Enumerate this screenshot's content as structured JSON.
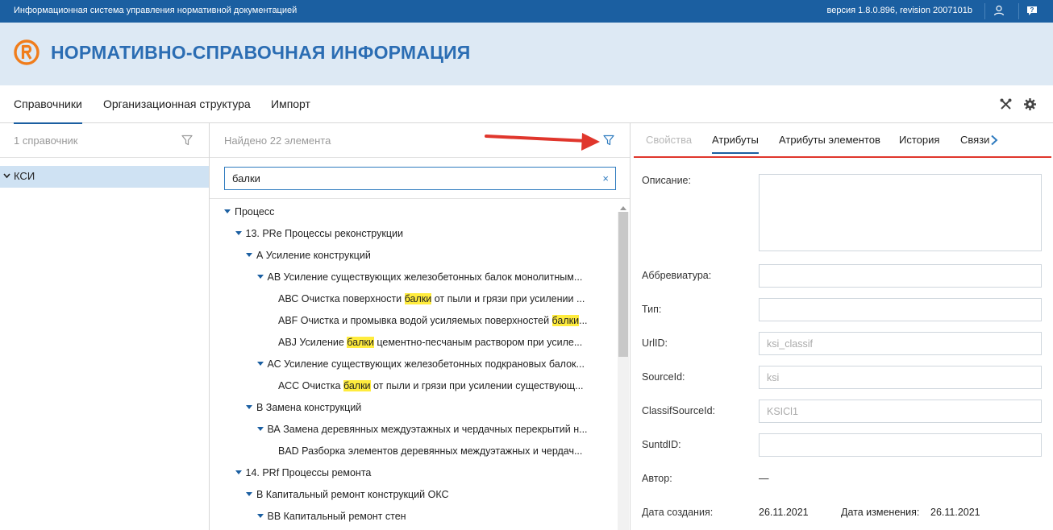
{
  "topbar": {
    "app_title": "Информационная система управления нормативной документацией",
    "version": "версия 1.8.0.896, revision 2007101b",
    "user_icon": "user-icon",
    "help_icon": "help-chat-icon"
  },
  "header": {
    "logo_icon": "brand-logo-icon",
    "title": "НОРМАТИВНО-СПРАВОЧНАЯ ИНФОРМАЦИЯ"
  },
  "nav": {
    "tabs": [
      {
        "label": "Справочники",
        "active": true
      },
      {
        "label": "Организационная структура",
        "active": false
      },
      {
        "label": "Импорт",
        "active": false
      }
    ],
    "tools_icon": "tools-icon",
    "settings_icon": "gear-icon"
  },
  "left_panel": {
    "count": "1 справочник",
    "filter_icon": "filter-icon",
    "items": [
      {
        "label": "КСИ",
        "selected": true
      }
    ]
  },
  "middle_panel": {
    "count": "Найдено 22 элемента",
    "filter_icon": "filter-icon",
    "search": {
      "value": "балки",
      "clear": "×"
    },
    "tree": [
      {
        "level": 0,
        "caret": true,
        "pre": "Процесс",
        "hl": "",
        "post": ""
      },
      {
        "level": 1,
        "caret": true,
        "pre": "13. PRe Процессы реконструкции",
        "hl": "",
        "post": ""
      },
      {
        "level": 2,
        "caret": true,
        "pre": "А Усиление конструкций",
        "hl": "",
        "post": ""
      },
      {
        "level": 3,
        "caret": true,
        "pre": "АВ Усиление существующих железобетонных балок монолитным...",
        "hl": "",
        "post": ""
      },
      {
        "level": 4,
        "caret": false,
        "pre": "АВС Очистка поверхности ",
        "hl": "балки",
        "post": " от пыли и грязи при усилении ..."
      },
      {
        "level": 4,
        "caret": false,
        "pre": "ABF Очистка и промывка водой усиляемых поверхностей ",
        "hl": "балки",
        "post": "..."
      },
      {
        "level": 4,
        "caret": false,
        "pre": "ABJ Усиление ",
        "hl": "балки",
        "post": " цементно-песчаным раствором при усиле..."
      },
      {
        "level": 3,
        "caret": true,
        "pre": "АС Усиление существующих железобетонных подкрановых балок...",
        "hl": "",
        "post": ""
      },
      {
        "level": 4,
        "caret": false,
        "pre": "АСС Очистка ",
        "hl": "балки",
        "post": " от пыли и грязи при усилении существующ..."
      },
      {
        "level": 2,
        "caret": true,
        "pre": "В Замена конструкций",
        "hl": "",
        "post": ""
      },
      {
        "level": 3,
        "caret": true,
        "pre": "ВА Замена деревянных междуэтажных и чердачных перекрытий н...",
        "hl": "",
        "post": ""
      },
      {
        "level": 4,
        "caret": false,
        "pre": "BAD Разборка элементов деревянных междуэтажных и чердач...",
        "hl": "",
        "post": ""
      },
      {
        "level": 1,
        "caret": true,
        "pre": "14. PRf Процессы ремонта",
        "hl": "",
        "post": ""
      },
      {
        "level": 2,
        "caret": true,
        "pre": "В Капитальный ремонт конструкций ОКС",
        "hl": "",
        "post": ""
      },
      {
        "level": 3,
        "caret": true,
        "pre": "ВВ Капитальный ремонт стен",
        "hl": "",
        "post": ""
      }
    ]
  },
  "right_panel": {
    "tabs": [
      {
        "label": "Свойства",
        "state": "disabled"
      },
      {
        "label": "Атрибуты",
        "state": "active"
      },
      {
        "label": "Атрибуты элементов",
        "state": "normal"
      },
      {
        "label": "История",
        "state": "normal"
      },
      {
        "label": "Связи",
        "state": "normal"
      }
    ],
    "next_icon": "chevron-right-icon",
    "fields": [
      {
        "label": "Описание:",
        "value": "",
        "multiline": true
      },
      {
        "label": "Аббревиатура:",
        "value": ""
      },
      {
        "label": "Тип:",
        "value": ""
      },
      {
        "label": "UrlID:",
        "value": "ksi_classif"
      },
      {
        "label": "SourceId:",
        "value": "ksi"
      },
      {
        "label": "ClassifSourceId:",
        "value": "KSICl1"
      },
      {
        "label": "SuntdID:",
        "value": ""
      }
    ],
    "author": {
      "label": "Автор:",
      "value": "—"
    },
    "created": {
      "label": "Дата создания:",
      "value": "26.11.2021"
    },
    "modified": {
      "label": "Дата изменения:",
      "value": "26.11.2021"
    }
  },
  "annotation": {
    "arrow_color": "#e0362c",
    "underline_color": "#e0362c"
  }
}
